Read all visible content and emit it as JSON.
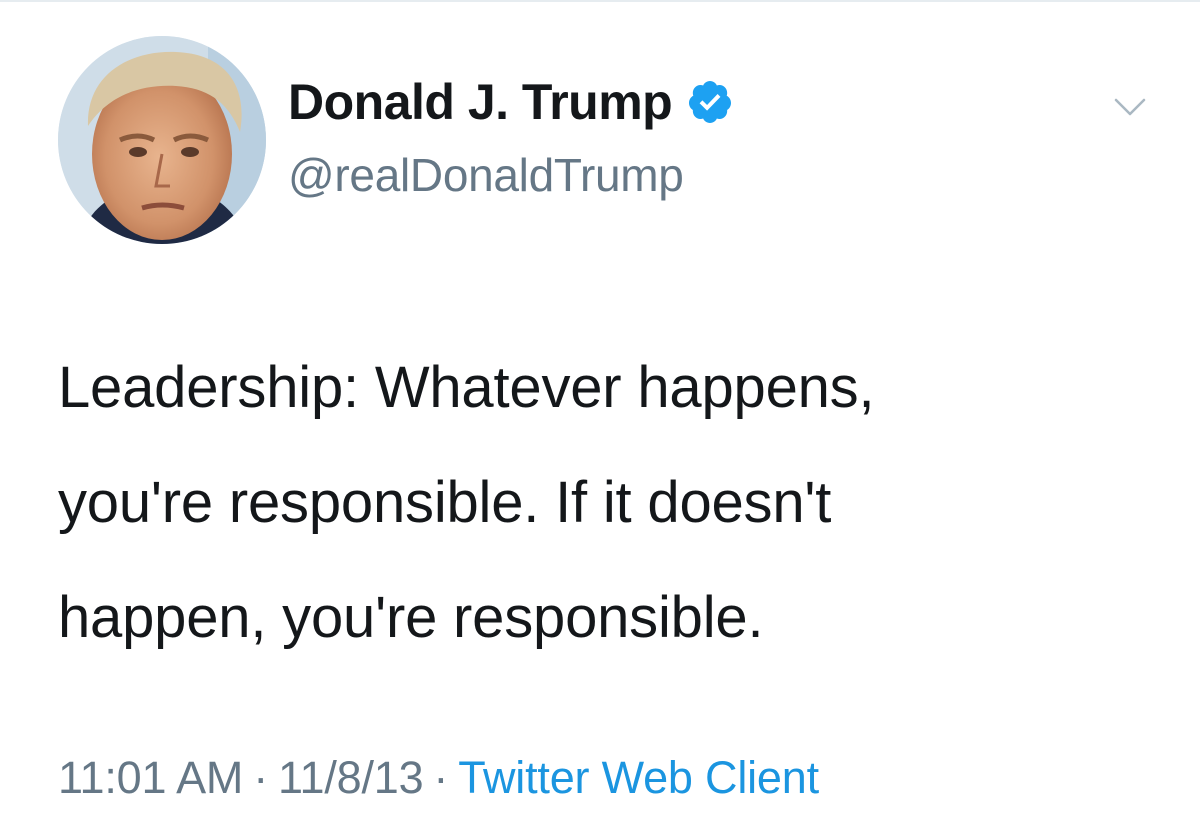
{
  "tweet": {
    "author": {
      "display_name": "Donald J. Trump",
      "handle": "@realDonaldTrump",
      "verified": true,
      "avatar_icon": "profile-photo",
      "badge_icon": "verified-badge-icon"
    },
    "text_lines": [
      "Leadership: Whatever happens,",
      "you're responsible. If it doesn't",
      "happen, you're responsible."
    ],
    "time": "11:01 AM",
    "date": "11/8/13",
    "separator": "·",
    "source": "Twitter Web Client",
    "menu_icon": "chevron-down-icon"
  },
  "colors": {
    "text_primary": "#14171a",
    "text_secondary": "#657786",
    "link": "#1b95e0",
    "verified": "#1da1f2"
  }
}
